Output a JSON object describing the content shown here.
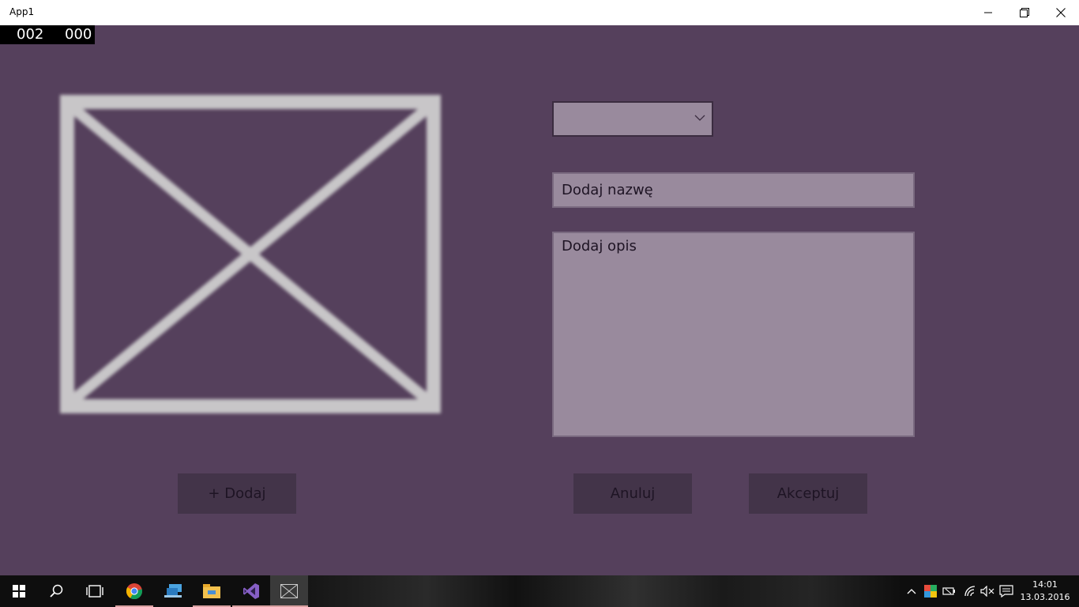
{
  "window": {
    "title": "App1"
  },
  "frame_counter": {
    "left": "002",
    "right": "000"
  },
  "form": {
    "category_select": {
      "selected": ""
    },
    "name_field": {
      "placeholder": "Dodaj nazwę",
      "value": ""
    },
    "description_field": {
      "placeholder": "Dodaj opis",
      "value": ""
    }
  },
  "buttons": {
    "add_label": "+ Dodaj",
    "cancel_label": "Anuluj",
    "accept_label": "Akceptuj"
  },
  "taskbar": {
    "items": [
      "start-icon",
      "search-icon",
      "task-view-icon",
      "chrome-icon",
      "network-app-icon",
      "file-explorer-icon",
      "visual-studio-icon",
      "app1-icon"
    ],
    "clock_time": "14:01",
    "clock_date": "13.03.2016"
  },
  "colors": {
    "app_background": "#55405c",
    "input_background": "#998a9d",
    "button_background": "#433449",
    "placeholder_stroke": "#c8c6c8"
  }
}
